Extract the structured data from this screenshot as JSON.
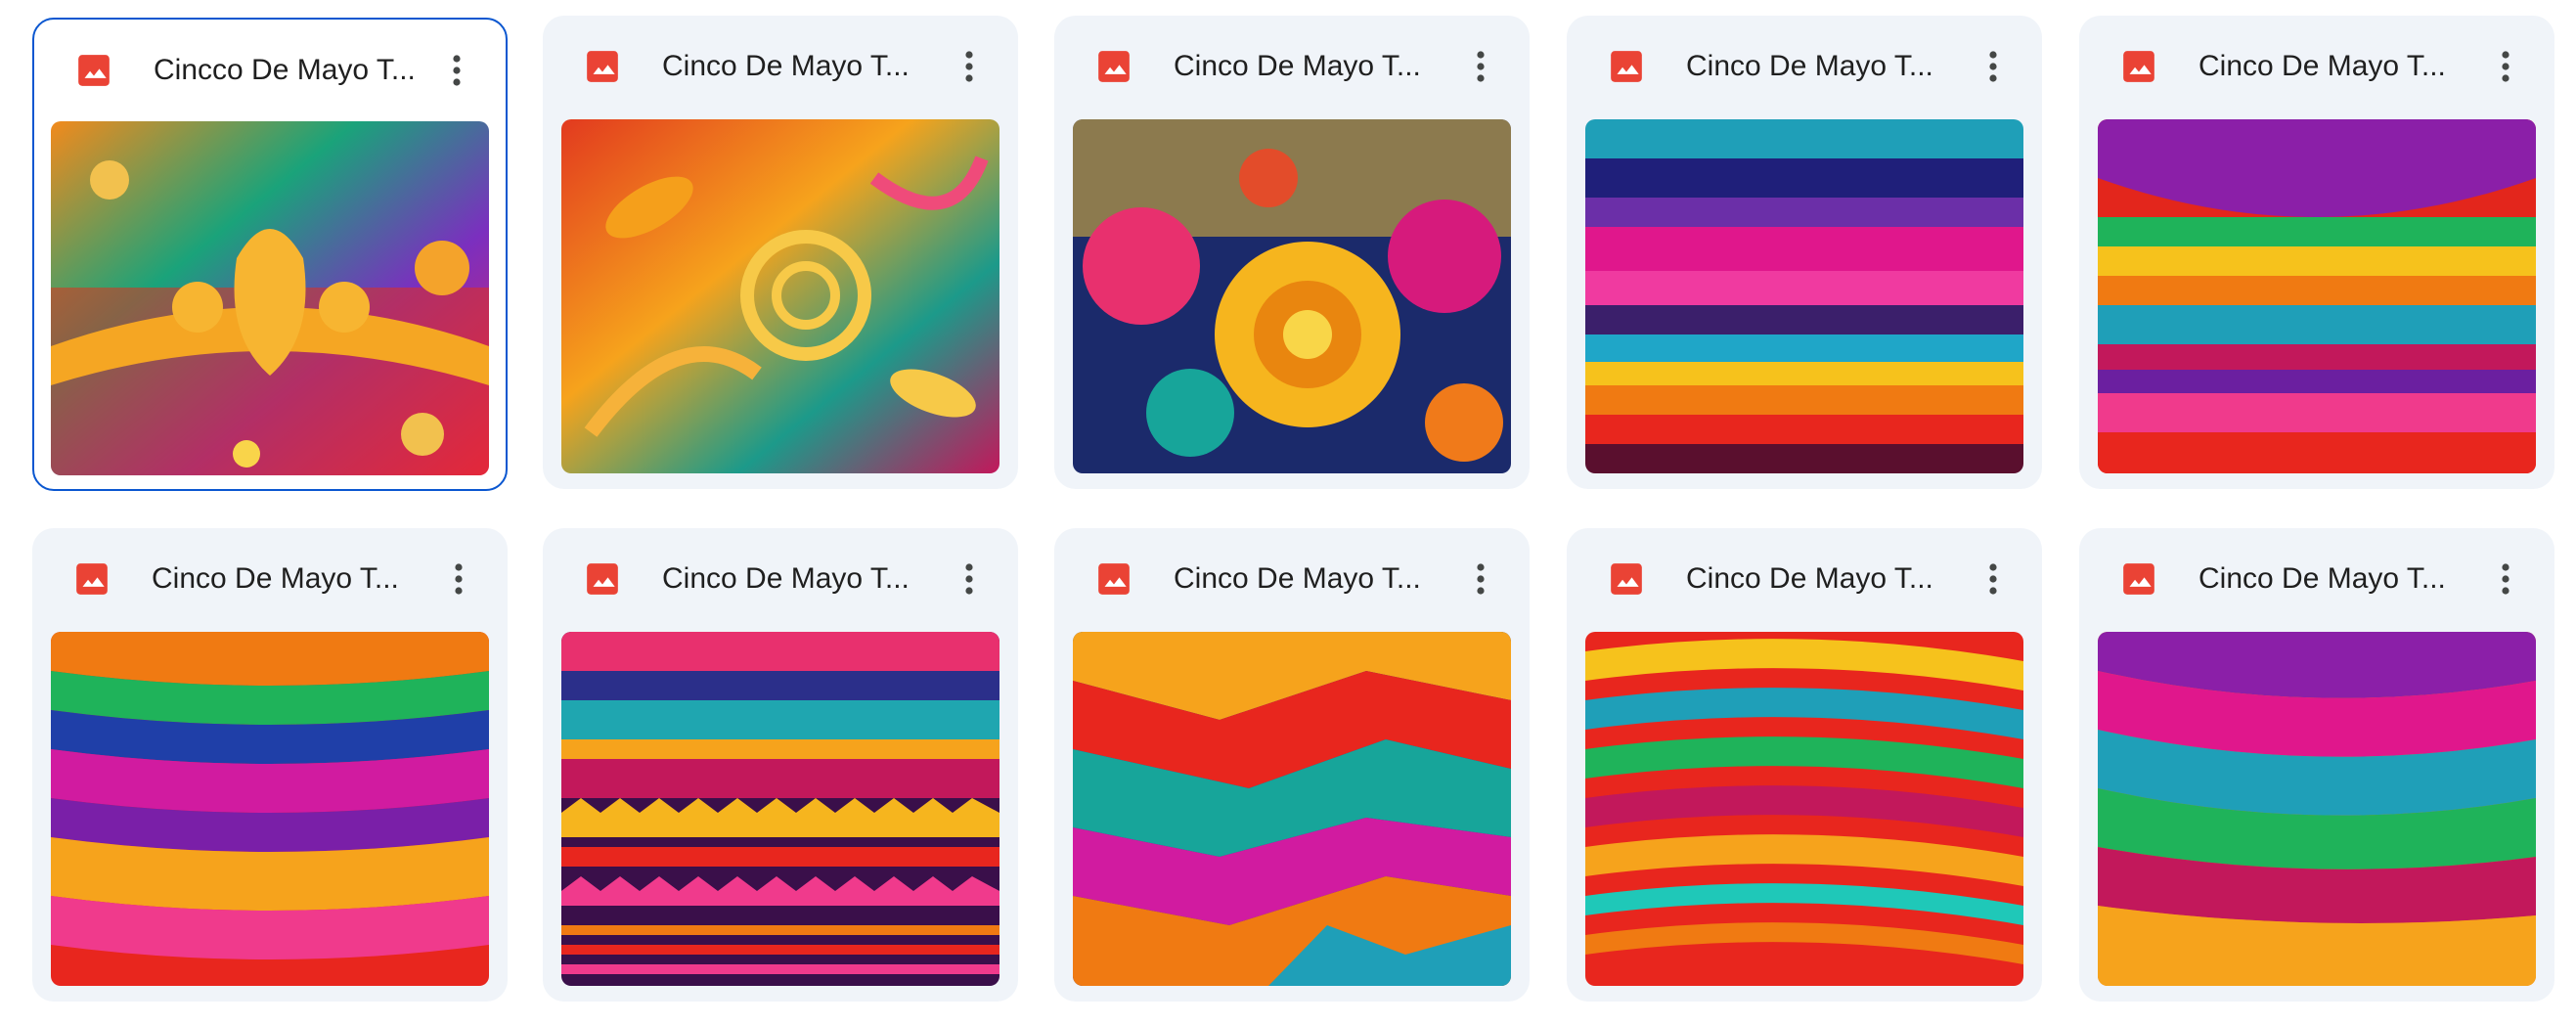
{
  "colors": {
    "card_bg": "#f0f4f9",
    "selected_border": "#0b57d0",
    "image_icon": "#ea4335",
    "text": "#1f1f1f"
  },
  "files": [
    {
      "name": "Cincco De Mayo T...",
      "icon": "image-file-icon",
      "selected": true,
      "thumb": "folk-floral-pattern"
    },
    {
      "name": "Cinco De Mayo T...",
      "icon": "image-file-icon",
      "selected": false,
      "thumb": "swirl-leaf-pattern"
    },
    {
      "name": "Cinco De Mayo T...",
      "icon": "image-file-icon",
      "selected": false,
      "thumb": "paisley-flower-pattern"
    },
    {
      "name": "Cinco De Mayo T...",
      "icon": "image-file-icon",
      "selected": false,
      "thumb": "woven-stripes"
    },
    {
      "name": "Cinco De Mayo T...",
      "icon": "image-file-icon",
      "selected": false,
      "thumb": "draped-stripes"
    },
    {
      "name": "Cinco De Mayo T...",
      "icon": "image-file-icon",
      "selected": false,
      "thumb": "wavy-stripes"
    },
    {
      "name": "Cinco De Mayo T...",
      "icon": "image-file-icon",
      "selected": false,
      "thumb": "geometric-stripes"
    },
    {
      "name": "Cinco De Mayo T...",
      "icon": "image-file-icon",
      "selected": false,
      "thumb": "paper-layers"
    },
    {
      "name": "Cinco De Mayo T...",
      "icon": "image-file-icon",
      "selected": false,
      "thumb": "curved-stripes"
    },
    {
      "name": "Cinco De Mayo T...",
      "icon": "image-file-icon",
      "selected": false,
      "thumb": "embossed-bands"
    }
  ]
}
